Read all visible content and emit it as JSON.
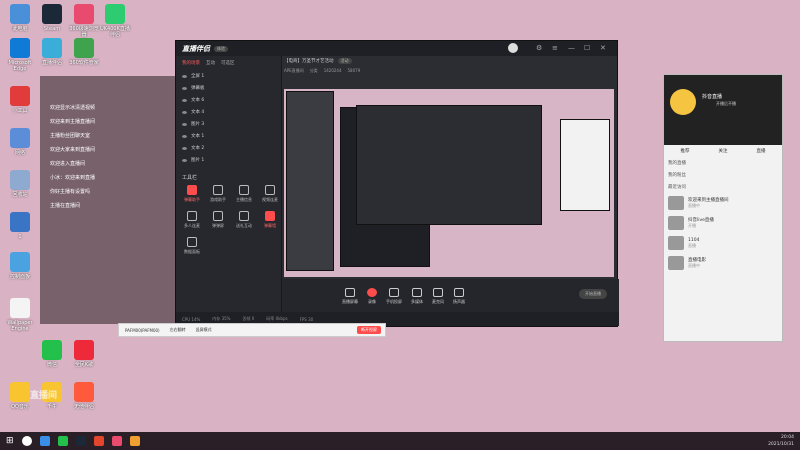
{
  "desktop_icons": [
    {
      "label": "此电脑",
      "color": "#4a90d9"
    },
    {
      "label": "Steam",
      "color": "#1b2838"
    },
    {
      "label": "360极速浏览器",
      "color": "#e94b6e"
    },
    {
      "label": "UK400K直播伴侣",
      "color": "#2ecc71"
    },
    {
      "label": "Microsoft Edge",
      "color": "#0f7bd6"
    },
    {
      "label": "直播伴侣",
      "color": "#3aaed8"
    },
    {
      "label": "360软件管家",
      "color": "#3fa34d"
    },
    {
      "label": "小工具",
      "color": "#e23b3b"
    },
    {
      "label": "网络",
      "color": "#5b8dd8"
    },
    {
      "label": "回收站",
      "color": "#8faad0"
    },
    {
      "label": "1",
      "color": "#3a74c4"
    },
    {
      "label": "控制面板",
      "color": "#4aa3e0"
    },
    {
      "label": "Wallpaper Engine",
      "color": "#f4f4f4"
    },
    {
      "label": "微信",
      "color": "#23c04b"
    },
    {
      "label": "全民K歌",
      "color": "#ee2a3a"
    },
    {
      "label": "QQ音乐",
      "color": "#f8c530"
    },
    {
      "label": "千牛",
      "color": "#f8c530"
    },
    {
      "label": "无他伴侣",
      "color": "#ff5a3c"
    }
  ],
  "overlay_chat": [
    "欢迎显示冰清透视频",
    "欢迎来到主播直播间",
    "主播粉丝团聊天室",
    "欢迎大家来到直播间",
    "欢迎进入直播间",
    "小冰：欢迎来到直播",
    "你好主播有设置吗",
    "主播在直播间"
  ],
  "app": {
    "logo": "直播伴侣",
    "badge": "体验",
    "title": "【电商】万圣节才艺活动",
    "title_tag": "活动",
    "info_items": [
      "APE直播间",
      "分类",
      "1420244",
      "58079"
    ],
    "tabs": [
      "我的场景",
      "互动",
      "可选区"
    ],
    "layers": [
      "全屏 1",
      "弹幕板",
      "文本 6",
      "文本 4",
      "图片 3",
      "文本 1",
      "文本 2",
      "图片 1"
    ],
    "tools_title": "工具栏",
    "tools": [
      {
        "label": "弹幕助手",
        "red": true
      },
      {
        "label": "游戏助手",
        "red": false
      },
      {
        "label": "主播信息",
        "red": false
      },
      {
        "label": "视频连麦",
        "red": false
      },
      {
        "label": "多人连麦",
        "red": false
      },
      {
        "label": "弹弹屏",
        "red": false
      },
      {
        "label": "送礼互动",
        "red": false
      },
      {
        "label": "弹幕墙",
        "red": true
      },
      {
        "label": "数据面板",
        "red": false
      }
    ],
    "bottom_items": [
      {
        "label": "直播屏幕",
        "red": false
      },
      {
        "label": "录像",
        "red": true
      },
      {
        "label": "手机投屏",
        "red": false
      },
      {
        "label": "多媒体",
        "red": false
      },
      {
        "label": "麦克风",
        "red": false
      },
      {
        "label": "扬声器",
        "red": false
      }
    ],
    "live_button": "开始直播",
    "status": [
      "CPU 14%",
      "内存 35%",
      "丢帧 0",
      "码率 0kbps",
      "FPS 30"
    ],
    "sub_bar": {
      "device": "PAFM00(PAFM00)",
      "opt1": "左右翻转",
      "opt2": "竖屏模式",
      "button": "断开投屏"
    }
  },
  "phone": {
    "name": "抖音直播",
    "subtitle": "开播后不播",
    "tabs": [
      "推荐",
      "关注",
      "直播"
    ],
    "sections": [
      "我的直播",
      "我的粉丝",
      "最近访问"
    ],
    "rows": [
      {
        "title": "欢迎来到主播直播间",
        "sub": "直播中"
      },
      {
        "title": "抖音live直播",
        "sub": "开播"
      },
      {
        "title": "1104",
        "sub": "直播"
      },
      {
        "title": "直播电影",
        "sub": "直播中"
      }
    ]
  },
  "taskbar": {
    "time": "20:04",
    "date": "2021/10/31"
  },
  "watermark": "直播间"
}
